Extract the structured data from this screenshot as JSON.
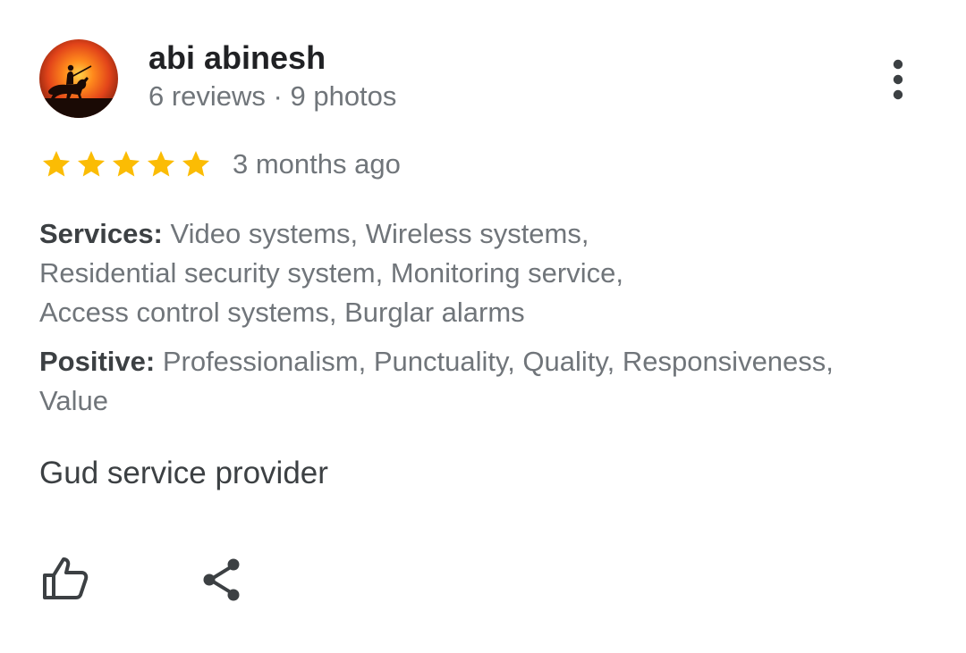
{
  "review": {
    "author": {
      "name": "abi abinesh",
      "meta": "6 reviews · 9 photos",
      "avatar_icon": "sunset-horse-rider-avatar"
    },
    "menu_icon": "more-vert-icon",
    "rating": {
      "stars": 5,
      "max_stars": 5,
      "star_color": "#fbbc04"
    },
    "date": "3 months ago",
    "attributes": {
      "services_label": "Services:",
      "services_lines": [
        " Video systems, Wireless systems,",
        "Residential security system, Monitoring service,",
        "Access control systems, Burglar alarms"
      ],
      "positive_label": "Positive:",
      "positive_lines": [
        " Professionalism, Punctuality, Quality, Responsiveness,",
        "Value"
      ]
    },
    "text": "Gud service provider",
    "actions": {
      "like_icon": "thumbs-up-icon",
      "share_icon": "share-icon"
    }
  }
}
